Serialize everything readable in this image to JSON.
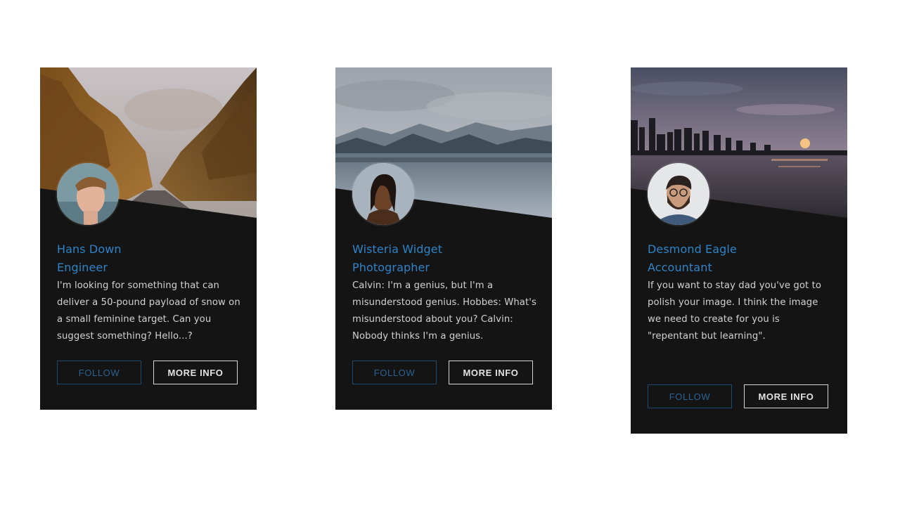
{
  "cards": [
    {
      "name": "Hans Down",
      "role": "Engineer",
      "bio": "I'm looking for something that can deliver a 50-pound payload of snow on a small feminine target. Can you suggest something? Hello...?",
      "follow_label": "FOLLOW",
      "more_label": "MORE INFO",
      "header_image": "autumn-forest-road",
      "avatar_image": "young-man-portrait"
    },
    {
      "name": "Wisteria Widget",
      "role": "Photographer",
      "bio": "Calvin: I'm a genius, but I'm a misunderstood genius. Hobbes: What's misunderstood about you? Calvin: Nobody thinks I'm a genius.",
      "follow_label": "FOLLOW",
      "more_label": "MORE INFO",
      "header_image": "mountain-lake",
      "avatar_image": "woman-portrait"
    },
    {
      "name": "Desmond Eagle",
      "role": "Accountant",
      "bio": "If you want to stay dad you've got to polish your image. I think the image we need to create for you is \"repentant but learning\".",
      "follow_label": "FOLLOW",
      "more_label": "MORE INFO",
      "header_image": "city-skyline-sunset",
      "avatar_image": "bearded-man-portrait"
    }
  ],
  "colors": {
    "card_bg": "#141414",
    "accent": "#2f83c7",
    "follow_border": "#1d4a70",
    "text": "#d2d2d2"
  }
}
